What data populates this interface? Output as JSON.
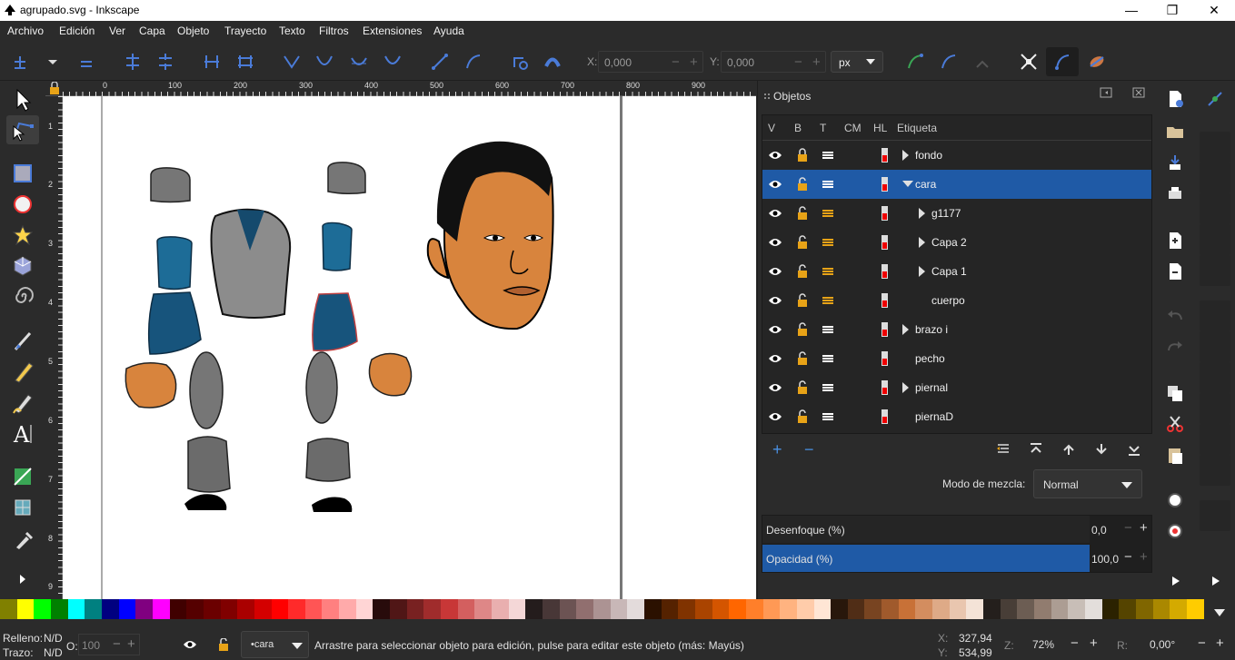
{
  "window": {
    "title": "agrupado.svg - Inkscape",
    "minimize": "—",
    "maximize": "❐",
    "close": "✕"
  },
  "menu": [
    "Archivo",
    "Edición",
    "Ver",
    "Capa",
    "Objeto",
    "Trayecto",
    "Texto",
    "Filtros",
    "Extensiones",
    "Ayuda"
  ],
  "controls": {
    "x_label": "X:",
    "x_value": "0,000",
    "y_label": "Y:",
    "y_value": "0,000",
    "unit": "px"
  },
  "ruler": {
    "top_labels": [
      "0",
      "100",
      "200",
      "300",
      "400",
      "500",
      "600",
      "700",
      "800",
      "900"
    ],
    "left_labels": [
      "1",
      "2",
      "3",
      "4",
      "5",
      "6",
      "7",
      "8",
      "9"
    ]
  },
  "objects_panel": {
    "title": "Objetos",
    "columns": [
      "V",
      "B",
      "T",
      "CM",
      "HL",
      "Etiqueta"
    ],
    "rows": [
      {
        "label": "fondo",
        "level": 0,
        "expander": "closed",
        "selected": false
      },
      {
        "label": "cara",
        "level": 0,
        "expander": "open",
        "selected": true
      },
      {
        "label": "g1177",
        "level": 1,
        "expander": "closed",
        "selected": false
      },
      {
        "label": "Capa 2",
        "level": 1,
        "expander": "closed",
        "selected": false
      },
      {
        "label": "Capa 1",
        "level": 1,
        "expander": "closed",
        "selected": false
      },
      {
        "label": "cuerpo",
        "level": 1,
        "expander": "none",
        "selected": false
      },
      {
        "label": "brazo i",
        "level": 0,
        "expander": "closed",
        "selected": false
      },
      {
        "label": "pecho",
        "level": 0,
        "expander": "none",
        "selected": false
      },
      {
        "label": "piernal",
        "level": 0,
        "expander": "closed",
        "selected": false
      },
      {
        "label": "piernaD",
        "level": 0,
        "expander": "none",
        "selected": false
      }
    ],
    "add_label": "+",
    "remove_label": "−",
    "blend_label": "Modo de mezcla:",
    "blend_value": "Normal",
    "blur_label": "Desenfoque (%)",
    "blur_value": "0,0",
    "opacity_label": "Opacidad (%)",
    "opacity_value": "100,0"
  },
  "palette": [
    "#808000",
    "#ffff00",
    "#00ff00",
    "#008000",
    "#00ffff",
    "#008080",
    "#000080",
    "#0000ff",
    "#800080",
    "#ff00ff",
    "#400000",
    "#550000",
    "#6b0000",
    "#800000",
    "#aa0000",
    "#d40000",
    "#ff0000",
    "#ff2a2a",
    "#ff5555",
    "#ff8080",
    "#ffaaaa",
    "#ffd5d5",
    "#280b0b",
    "#501616",
    "#782121",
    "#a02c2c",
    "#c83737",
    "#d35f5f",
    "#de8787",
    "#e9afaf",
    "#f4d7d7",
    "#241c1c",
    "#483737",
    "#6c5353",
    "#916f6f",
    "#ac9393",
    "#c8b7b7",
    "#e3dbdb",
    "#2b1100",
    "#552200",
    "#803300",
    "#aa4400",
    "#d45500",
    "#ff6600",
    "#ff7f2a",
    "#ff9955",
    "#ffb380",
    "#ffccaa",
    "#ffe6d5",
    "#28170b",
    "#502d16",
    "#784421",
    "#a05a2c",
    "#c87137",
    "#d38d5f",
    "#deaa87",
    "#e9c6af",
    "#f4e3d7",
    "#241f1c",
    "#483e37",
    "#6c5d53",
    "#917c6f",
    "#ac9d93",
    "#c8beb7",
    "#e3dedb",
    "#2b2200",
    "#554400",
    "#806600",
    "#aa8800",
    "#d4aa00",
    "#ffcc00"
  ],
  "status": {
    "fill_label": "Relleno:",
    "fill_value": "N/D",
    "stroke_label": "Trazo:",
    "stroke_value": "N/D",
    "opacity_label": "O:",
    "opacity_value": "100",
    "layer": "•cara",
    "message": "Arrastre para seleccionar objeto para edición, pulse para editar este objeto (más: Mayús)",
    "x_label": "X:",
    "x_value": "327,94",
    "y_label": "Y:",
    "y_value": "534,99",
    "zoom_label": "Z:",
    "zoom_value": "72%",
    "rotate_label": "R:",
    "rotate_value": "0,00°"
  }
}
